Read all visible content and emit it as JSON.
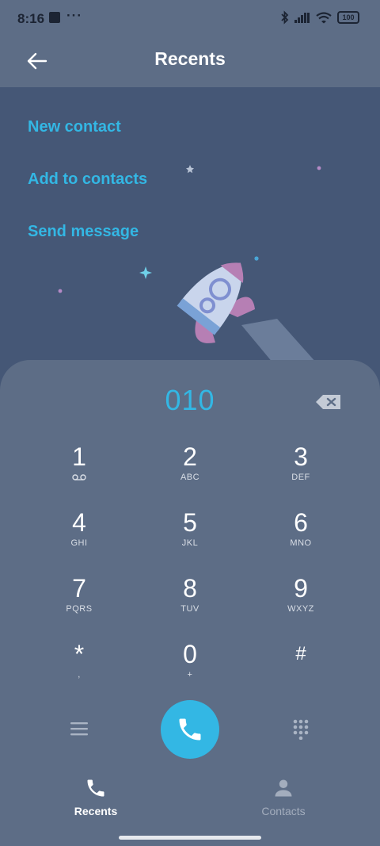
{
  "status_bar": {
    "time": "8:16",
    "notif_dots": "···",
    "battery": "100"
  },
  "app_bar": {
    "title": "Recents"
  },
  "actions": [
    {
      "label": "New contact"
    },
    {
      "label": "Add to contacts"
    },
    {
      "label": "Send message"
    }
  ],
  "dialer": {
    "number": "010",
    "keys": [
      {
        "digit": "1",
        "letters": ""
      },
      {
        "digit": "2",
        "letters": "ABC"
      },
      {
        "digit": "3",
        "letters": "DEF"
      },
      {
        "digit": "4",
        "letters": "GHI"
      },
      {
        "digit": "5",
        "letters": "JKL"
      },
      {
        "digit": "6",
        "letters": "MNO"
      },
      {
        "digit": "7",
        "letters": "PQRS"
      },
      {
        "digit": "8",
        "letters": "TUV"
      },
      {
        "digit": "9",
        "letters": "WXYZ"
      },
      {
        "digit": "*",
        "letters": ","
      },
      {
        "digit": "0",
        "letters": "+"
      },
      {
        "digit": "#",
        "letters": ""
      }
    ]
  },
  "tabs": [
    {
      "label": "Recents",
      "icon": "phone-icon",
      "active": true
    },
    {
      "label": "Contacts",
      "icon": "person-icon",
      "active": false
    }
  ],
  "colors": {
    "accent": "#33b7e4",
    "surface": "#5d6d86",
    "background": "#455776"
  }
}
